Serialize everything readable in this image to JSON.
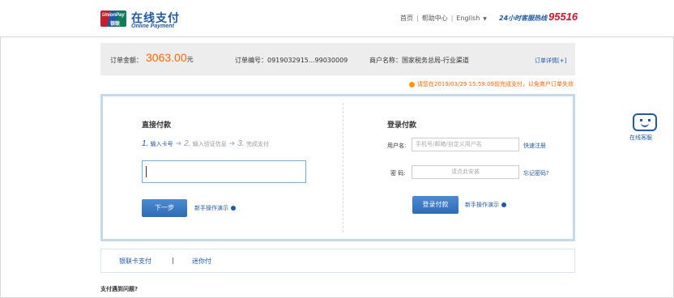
{
  "header": {
    "logo_unionpay": "UnionPay",
    "logo_yinlian": "银联",
    "logo_cn": "在线支付",
    "logo_en": "Online Payment",
    "nav": {
      "home": "首页",
      "help": "帮助中心",
      "language": "English"
    },
    "hotline_label": "24小时客服热线",
    "hotline_number": "95516"
  },
  "order": {
    "amount_label": "订单金额：",
    "amount_value": "3063.00",
    "amount_unit": "元",
    "order_no_label": "订单编号：",
    "order_no_value": "0919032915...99030009",
    "merchant_label": "商户名称：",
    "merchant_value": "国家税务总局-行业渠道",
    "detail_link": "订单详情[+]"
  },
  "notice": "请您在2019/03/29 15:59:09前完成支付，以免商户订单失效",
  "direct_pay": {
    "title": "直接付款",
    "steps": [
      {
        "num": "1.",
        "label": "输入卡号"
      },
      {
        "num": "2.",
        "label": "输入验证信息"
      },
      {
        "num": "3.",
        "label": "完成支付"
      }
    ],
    "next_button": "下一步",
    "help_link": "新手操作演示"
  },
  "login_pay": {
    "title": "登录付款",
    "username_label": "用户名:",
    "username_placeholder": "手机号/邮箱/自定义用户名",
    "register_link": "快速注册",
    "password_label": "密  码:",
    "password_placeholder": "请点此安装",
    "forgot_link": "忘记密码?",
    "login_button": "登录付款",
    "help_link": "新手操作演示"
  },
  "bottom_tabs": {
    "tab1": "银联卡支付",
    "separator": "|",
    "tab2": "迷你付"
  },
  "problem_text": "支付遇到问题?",
  "service_label": "在线客服",
  "colors": {
    "brand_blue": "#1e5aa8",
    "amount_orange": "#ff6600",
    "hotline_red": "#c8182b"
  }
}
